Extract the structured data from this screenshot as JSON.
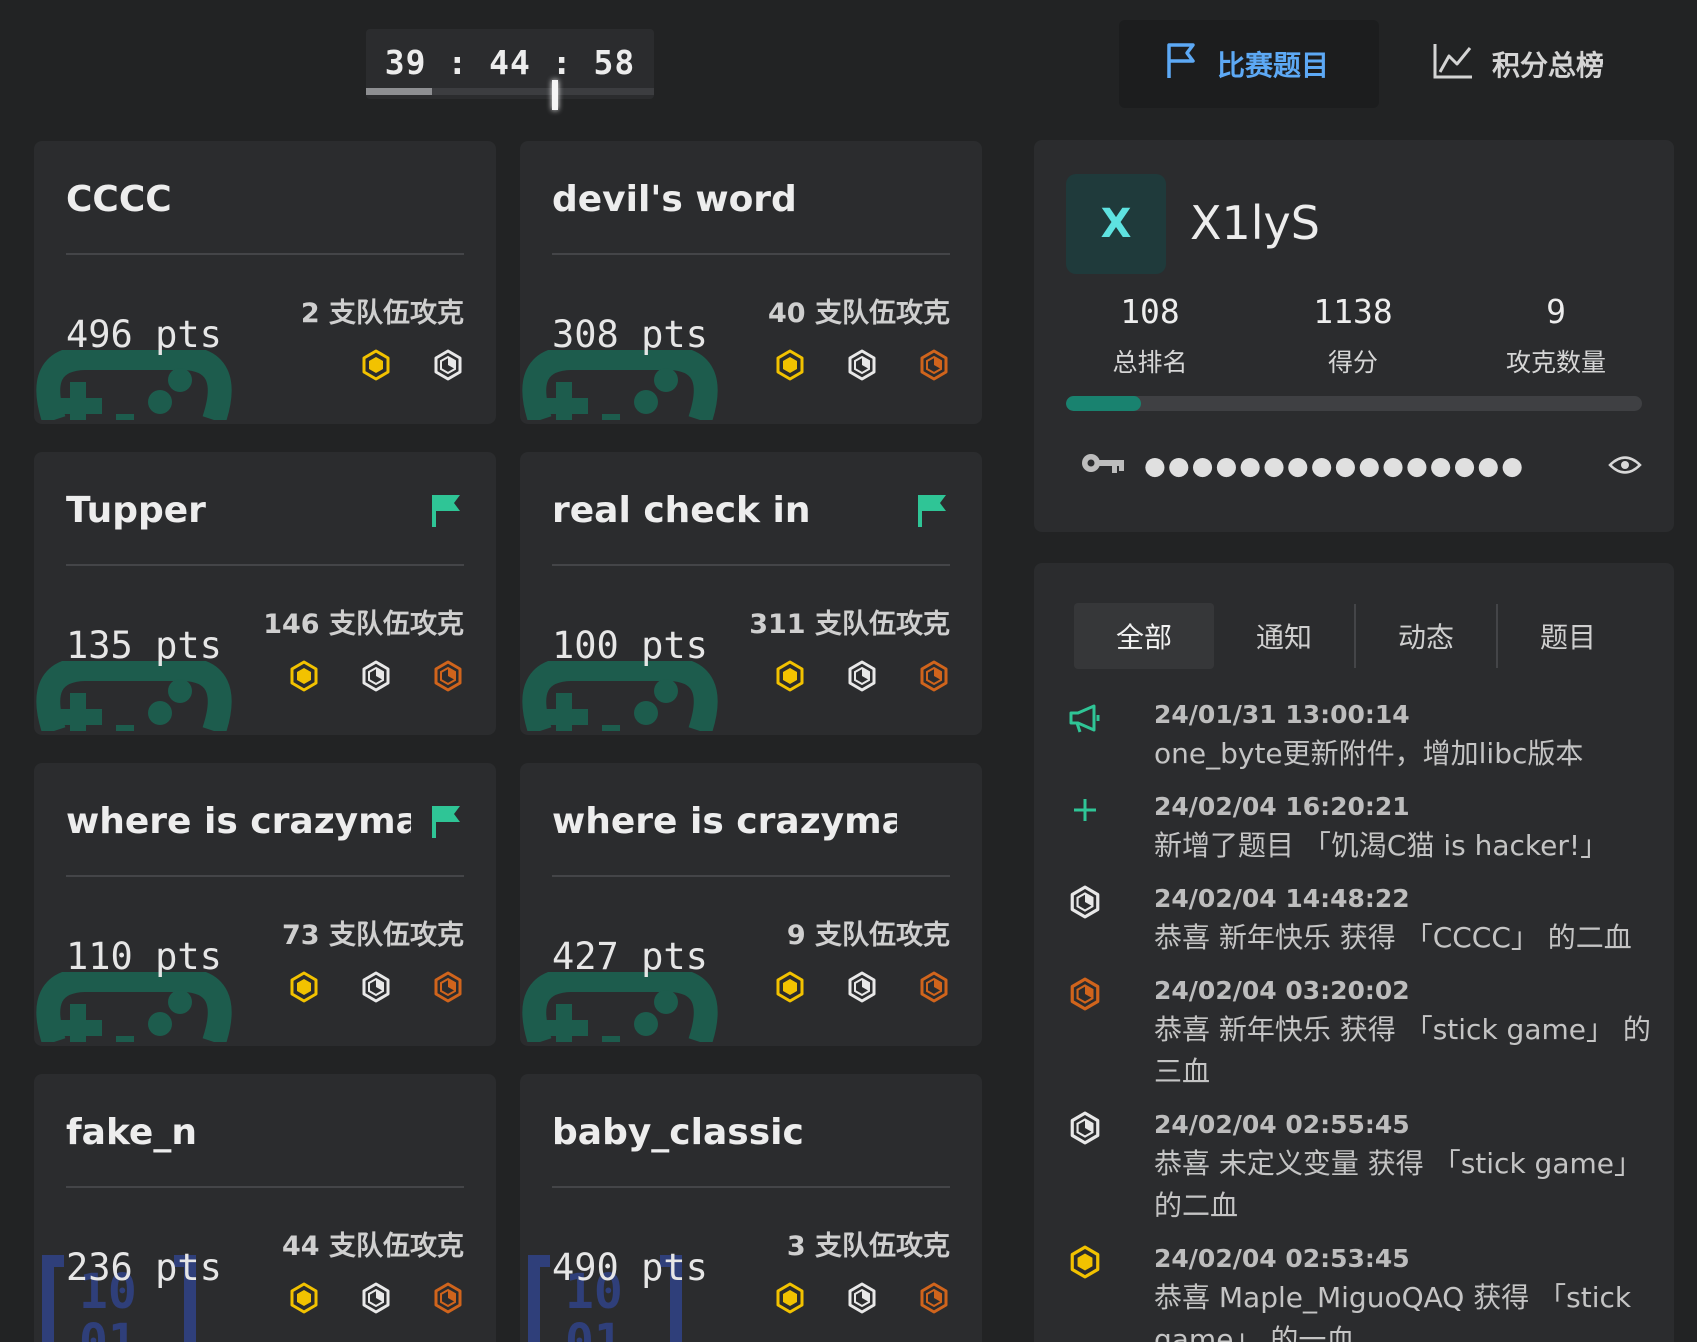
{
  "timer": {
    "text": "39 : 44 : 58",
    "progress": 0.23
  },
  "nav": {
    "challenges_label": "比赛题目",
    "scoreboard_label": "积分总榜",
    "accent": "#5da9f5"
  },
  "cards": [
    {
      "title": "CCCC",
      "pts": "496 pts",
      "solves": "2 支队伍攻克",
      "flag": false,
      "medals": [
        "gold",
        "silver"
      ],
      "bg_icon": "gamepad-icon"
    },
    {
      "title": "devil's word",
      "pts": "308 pts",
      "solves": "40 支队伍攻克",
      "flag": false,
      "medals": [
        "gold",
        "silver",
        "bronze"
      ],
      "bg_icon": "gamepad-icon"
    },
    {
      "title": "Tupper",
      "pts": "135 pts",
      "solves": "146 支队伍攻克",
      "flag": true,
      "medals": [
        "gold",
        "silver",
        "bronze"
      ],
      "bg_icon": "gamepad-icon"
    },
    {
      "title": "real check in",
      "pts": "100 pts",
      "solves": "311 支队伍攻克",
      "flag": true,
      "medals": [
        "gold",
        "silver",
        "bronze"
      ],
      "bg_icon": "gamepad-icon"
    },
    {
      "title": "where is crazyma...",
      "pts": "110 pts",
      "solves": "73 支队伍攻克",
      "flag": true,
      "medals": [
        "gold",
        "silver",
        "bronze"
      ],
      "bg_icon": "gamepad-icon"
    },
    {
      "title": "where is crazyma...",
      "pts": "427 pts",
      "solves": "9 支队伍攻克",
      "flag": false,
      "medals": [
        "gold",
        "silver",
        "bronze"
      ],
      "bg_icon": "gamepad-icon"
    },
    {
      "title": "fake_n",
      "pts": "236 pts",
      "solves": "44 支队伍攻克",
      "flag": false,
      "medals": [
        "gold",
        "silver",
        "bronze"
      ],
      "bg_icon": "binary-icon"
    },
    {
      "title": "baby_classic",
      "pts": "490 pts",
      "solves": "3 支队伍攻克",
      "flag": false,
      "medals": [
        "gold",
        "silver",
        "bronze"
      ],
      "bg_icon": "binary-icon"
    }
  ],
  "team": {
    "avatar_letter": "X",
    "name": "X1lyS",
    "rank": "108",
    "rank_label": "总排名",
    "score": "1138",
    "score_label": "得分",
    "solved": "9",
    "solved_label": "攻克数量",
    "progress": 0.13,
    "token_masked": "●●●●●●●●●●●●●●●●"
  },
  "feed": {
    "tabs": [
      "全部",
      "通知",
      "动态",
      "题目"
    ],
    "active_tab": 0,
    "items": [
      {
        "icon": "megaphone-icon",
        "time": "24/01/31 13:00:14",
        "message": "one_byte更新附件，增加libc版本"
      },
      {
        "icon": "plus-icon",
        "time": "24/02/04 16:20:21",
        "message": "新增了题目 「饥渴C猫 is hacker!」"
      },
      {
        "icon": "silver-medal-icon",
        "time": "24/02/04 14:48:22",
        "message": "恭喜 新年快乐 获得 「CCCC」 的二血"
      },
      {
        "icon": "bronze-medal-icon",
        "time": "24/02/04 03:20:02",
        "message": "恭喜 新年快乐 获得 「stick game」 的三血"
      },
      {
        "icon": "silver-medal-icon",
        "time": "24/02/04 02:55:45",
        "message": "恭喜 未定义变量 获得 「stick game」 的二血"
      },
      {
        "icon": "gold-medal-icon",
        "time": "24/02/04 02:53:45",
        "message": "恭喜 Maple_MiguoQAQ 获得 「stick game」 的一血"
      }
    ]
  },
  "colors": {
    "background": "#222324",
    "card": "#2b2c2e",
    "gold": "#f2c200",
    "silver": "#e8e8e8",
    "bronze": "#d0641c",
    "flag_green": "#2fc596",
    "gamepad_green": "#1d5c4d",
    "binary_blue": "#2f3f7a"
  }
}
